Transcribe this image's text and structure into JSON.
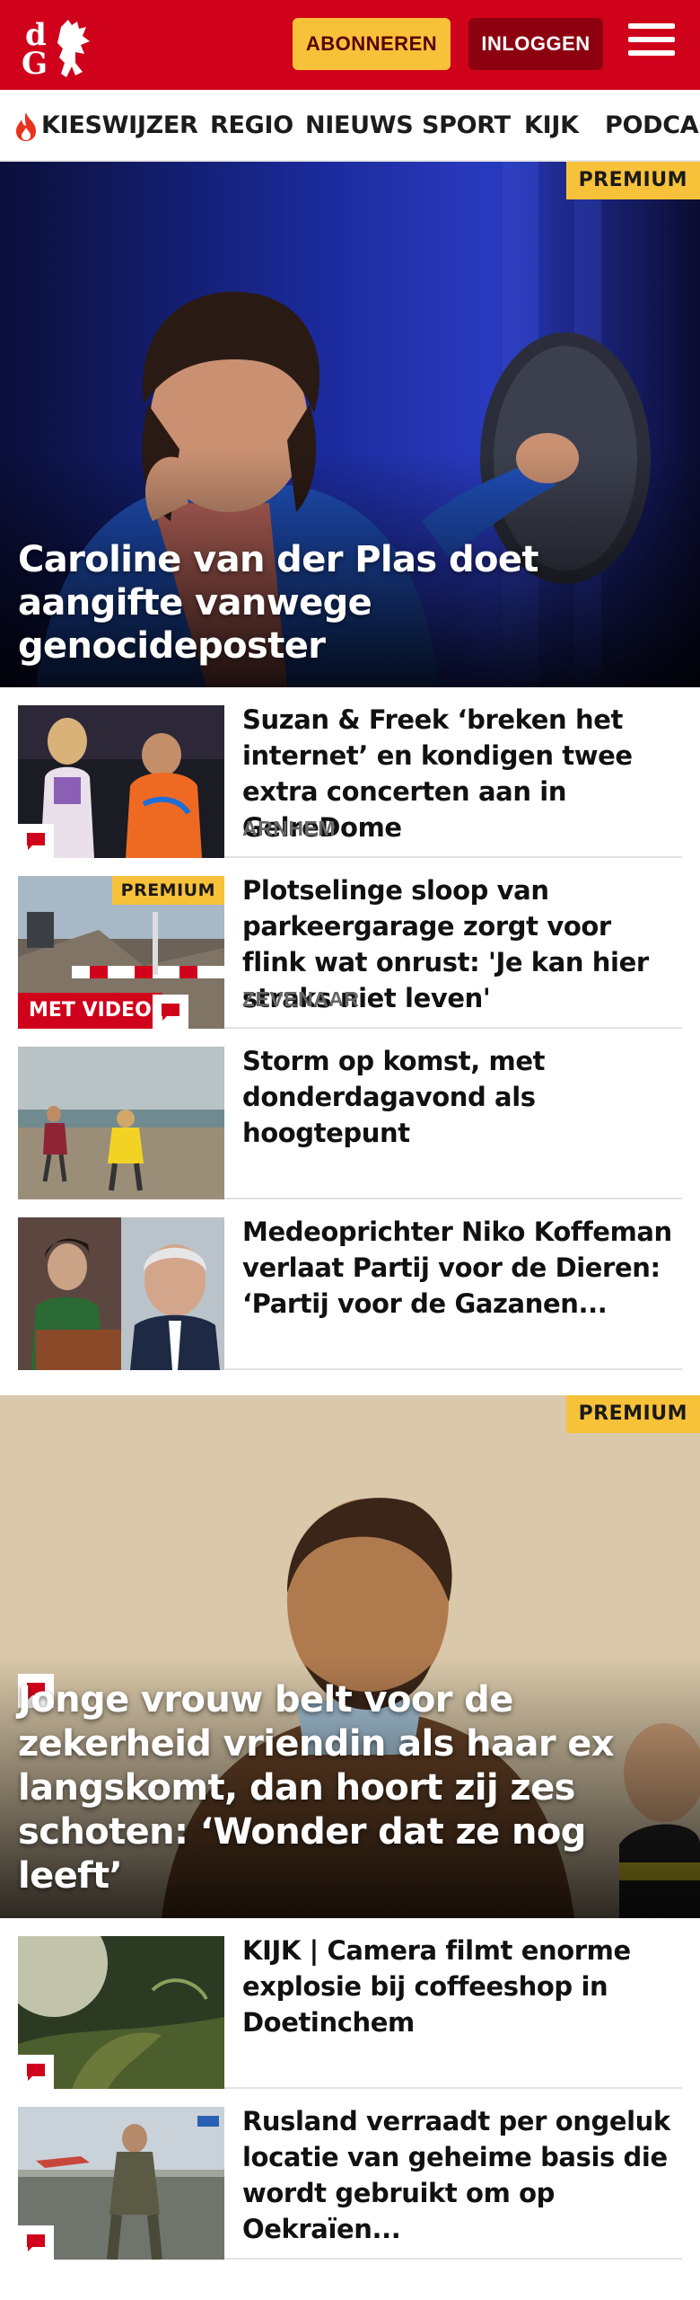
{
  "header": {
    "subscribe_label": "ABONNEREN",
    "login_label": "INLOGGEN",
    "brand_color": "#d0021b",
    "accent_color": "#f8c13a"
  },
  "nav": {
    "items": [
      {
        "label": "KIESWIJZER",
        "icon": "flame-icon"
      },
      {
        "label": "REGIO"
      },
      {
        "label": "NIEUWS"
      },
      {
        "label": "SPORT"
      },
      {
        "label": "KIJK"
      },
      {
        "label": "PODCAST"
      }
    ]
  },
  "hero": {
    "badge": "PREMIUM",
    "title": "Caroline van der Plas doet aangifte vanwege genocideposter"
  },
  "articles": [
    {
      "title": "Suzan & Freek ‘breken het internet’ en kondigen twee extra concerten aan in GelreDome",
      "location": "ARNHEM",
      "has_comments": true
    },
    {
      "title": "Plotselinge sloop van parkeerga­rage zorgt voor flink wat onrust: 'Je kan hier straks niet leven'",
      "location": "ZEVENAAR",
      "badge": "PREMIUM",
      "video_label": "MET VIDEO",
      "has_comments": true
    },
    {
      "title": "Storm op komst, met donderdag­avond als hoogtepunt"
    },
    {
      "title": "Medeoprichter Niko Koffeman verlaat Partij voor de Dieren: ‘Partij voor de Gazanen..."
    }
  ],
  "hero2": {
    "badge": "PREMIUM",
    "title": "Jonge vrouw belt voor de zekerheid vriendin als haar ex langskomt, dan hoort zij zes schoten: ‘Wonder dat ze nog leeft’",
    "has_comments": true
  },
  "articles2": [
    {
      "title": "KIJK | Camera filmt enorme explosie bij coffeeshop in Doetinchem",
      "has_comments": true
    },
    {
      "title": "Rusland verraadt per ongeluk locatie van geheime basis die wordt gebruikt om op Oekraïen...",
      "has_comments": true
    }
  ]
}
